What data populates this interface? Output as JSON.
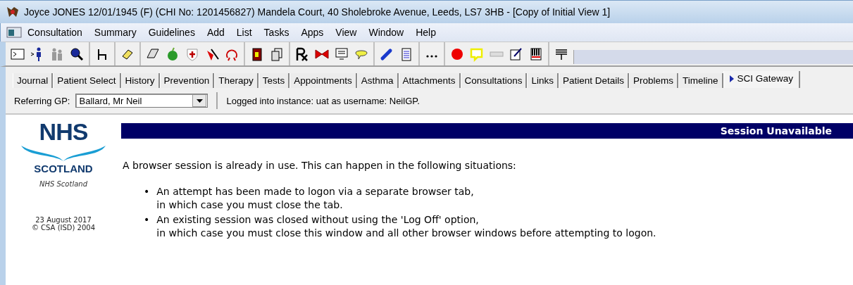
{
  "window": {
    "title": "Joyce JONES 12/01/1945 (F) (CHI No: 1201456827)  Mandela Court, 40 Sholebroke Avenue, Leeds, LS7 3HB - [Copy of Initial View 1]"
  },
  "menu": [
    {
      "label": "Consultation"
    },
    {
      "label": "Summary"
    },
    {
      "label": "Guidelines"
    },
    {
      "label": "Add"
    },
    {
      "label": "List"
    },
    {
      "label": "Tasks"
    },
    {
      "label": "Apps"
    },
    {
      "label": "View"
    },
    {
      "label": "Window"
    },
    {
      "label": "Help"
    }
  ],
  "tabs": [
    {
      "label": "Journal",
      "selected": false
    },
    {
      "label": "Patient Select",
      "selected": false
    },
    {
      "label": "History",
      "selected": false
    },
    {
      "label": "Prevention",
      "selected": false
    },
    {
      "label": "Therapy",
      "selected": false
    },
    {
      "label": "Tests",
      "selected": false
    },
    {
      "label": "Appointments",
      "selected": false
    },
    {
      "label": "Asthma",
      "selected": false
    },
    {
      "label": "Attachments",
      "selected": false
    },
    {
      "label": "Consultations",
      "selected": false
    },
    {
      "label": "Links",
      "selected": false
    },
    {
      "label": "Patient Details",
      "selected": false
    },
    {
      "label": "Problems",
      "selected": false
    },
    {
      "label": "Timeline",
      "selected": false
    },
    {
      "label": "SCI Gateway",
      "selected": true
    }
  ],
  "referring_gp": {
    "label": "Referring GP:",
    "value": "Ballard, Mr Neil"
  },
  "login_status": "Logged into instance: uat as username: NeilGP.",
  "sidebar": {
    "logo_top": "NHS",
    "logo_bottom": "SCOTLAND",
    "caption": "NHS Scotland",
    "date": "23 August 2017",
    "copyright": "© CSA (ISD) 2004"
  },
  "header": "Session Unavailable",
  "intro": "A browser session is already in use. This can happen in the following situations:",
  "bullets": [
    {
      "marker": "•",
      "lines": [
        "An attempt has been made to logon via a separate browser tab,",
        "in which case you must close the tab."
      ]
    },
    {
      "marker": "•",
      "lines": [
        "An existing session was closed without using the 'Log Off' option,",
        "in which case you must close this window and all other browser windows before attempting to logon."
      ]
    }
  ]
}
